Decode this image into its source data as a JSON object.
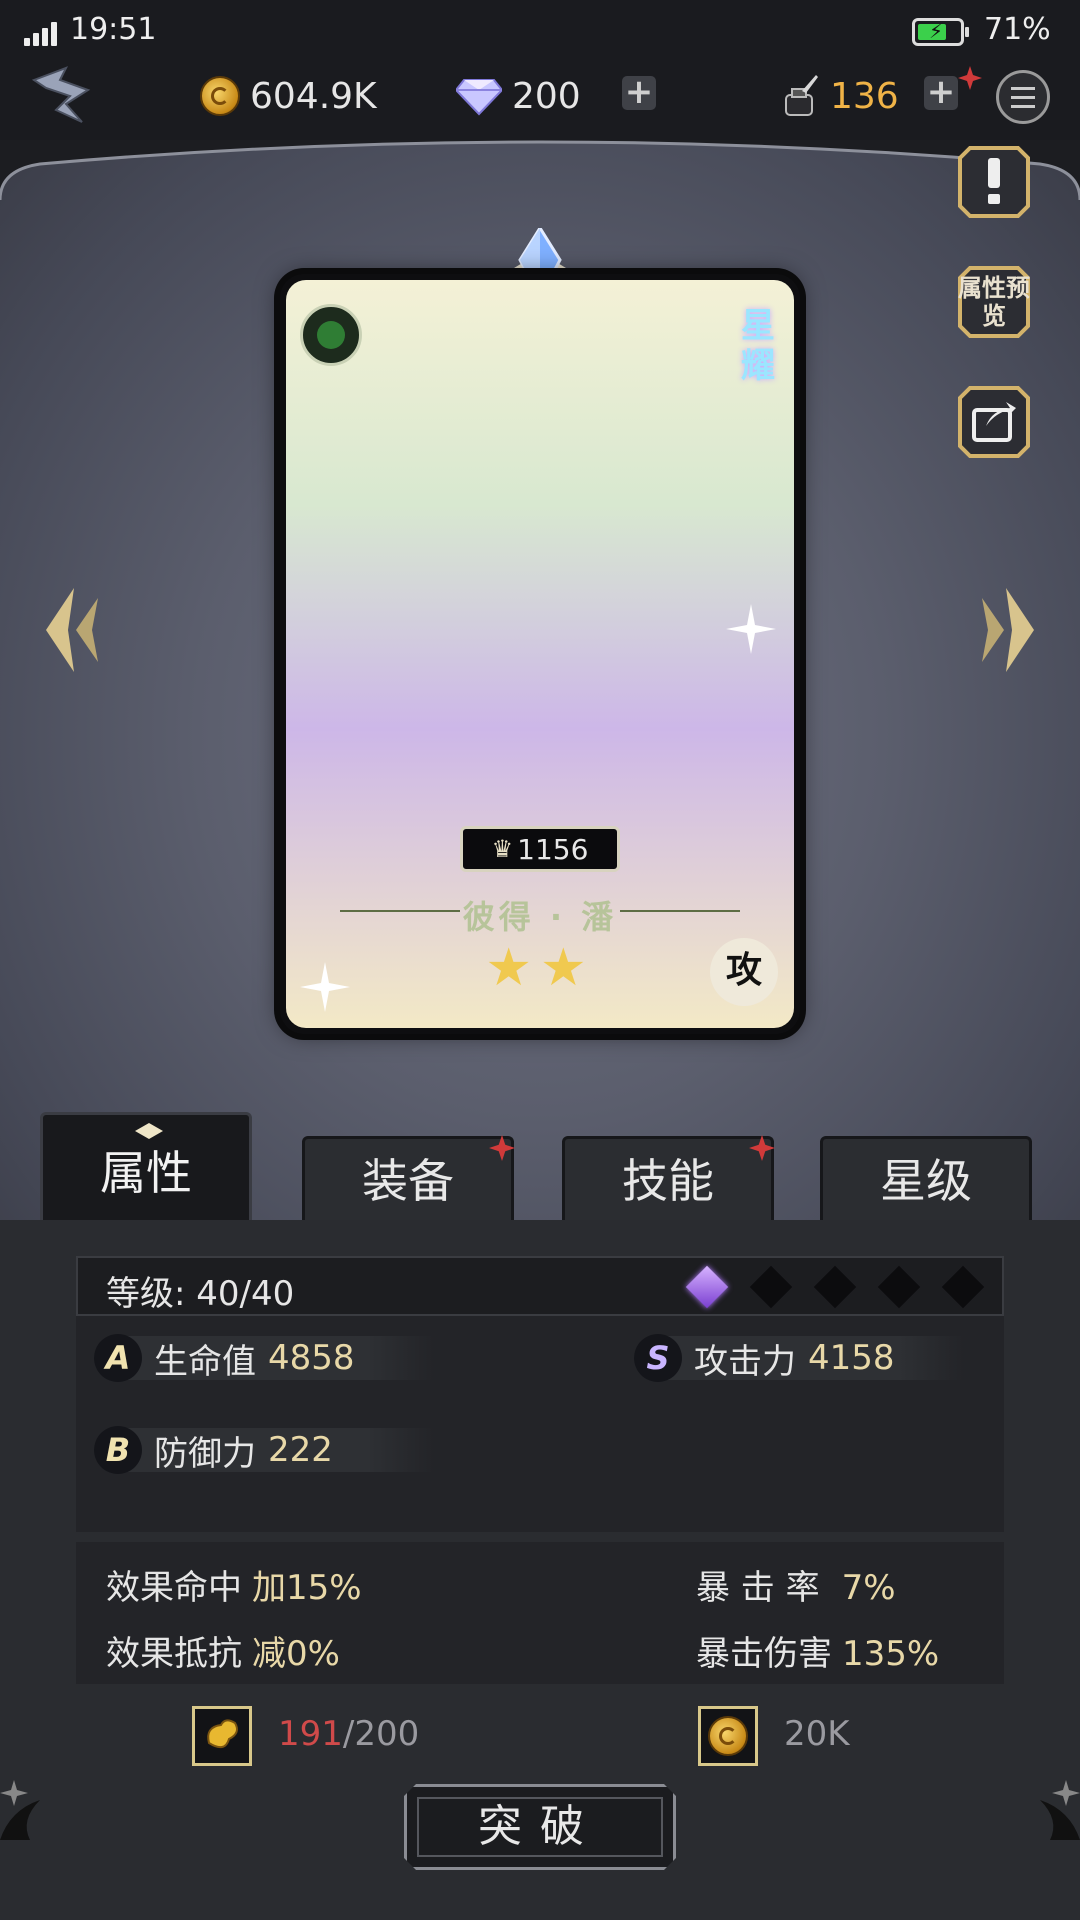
{
  "status_bar": {
    "time": "19:51",
    "battery": "71%",
    "battery_level": 0.71
  },
  "resources": {
    "gold": "604.9K",
    "diamonds": "200",
    "ink": "136"
  },
  "side_buttons": {
    "attr_preview": "属性预览"
  },
  "hero": {
    "rank_label": "星耀",
    "power": "1156",
    "name": "彼得 · 潘",
    "stars": "★★",
    "star_count": 2,
    "role": "攻"
  },
  "tabs": [
    {
      "label": "属性",
      "active": true,
      "has_alert": false
    },
    {
      "label": "装备",
      "active": false,
      "has_alert": true
    },
    {
      "label": "技能",
      "active": false,
      "has_alert": true
    },
    {
      "label": "星级",
      "active": false,
      "has_alert": false
    }
  ],
  "level": {
    "text": "等级: 40/40",
    "breakthrough_gems": 5,
    "gems_filled": 1
  },
  "stats": [
    {
      "grade": "A",
      "label": "生命值",
      "value": "4858"
    },
    {
      "grade": "S",
      "label": "攻击力",
      "value": "4158"
    },
    {
      "grade": "B",
      "label": "防御力",
      "value": "222"
    }
  ],
  "sub_stats": [
    {
      "label": "效果命中",
      "value": "加15%"
    },
    {
      "label": "暴 击 率",
      "value": "7%"
    },
    {
      "label": "效果抵抗",
      "value": "减0%"
    },
    {
      "label": "暴击伤害",
      "value": "135%"
    }
  ],
  "cost": {
    "material_have": "191",
    "material_need": "/200",
    "gold": "20K"
  },
  "breakthrough_button": "突破",
  "colors": {
    "accent_gold": "#e8d8a8",
    "alert_red": "#d03a3a",
    "panel": "#2a2c30"
  }
}
